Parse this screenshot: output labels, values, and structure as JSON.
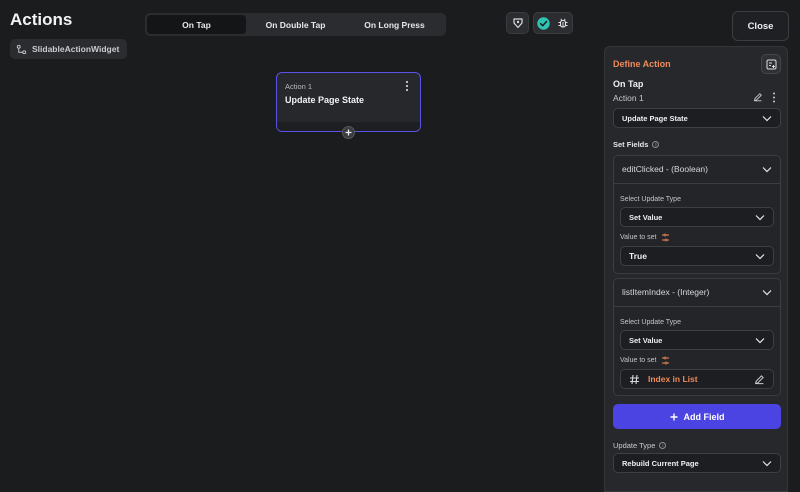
{
  "header": {
    "title": "Actions",
    "widget_chip": "SlidableActionWidget",
    "tabs": [
      {
        "label": "On Tap",
        "active": true
      },
      {
        "label": "On Double Tap",
        "active": false
      },
      {
        "label": "On Long Press",
        "active": false
      }
    ],
    "close_label": "Close"
  },
  "canvas": {
    "node": {
      "label": "Action 1",
      "name": "Update Page State"
    }
  },
  "panel": {
    "title": "Define Action",
    "trigger": "On Tap",
    "action_label": "Action 1",
    "action_type": "Update Page State",
    "set_fields_label": "Set Fields",
    "fields": [
      {
        "name": "editClicked - (Boolean)",
        "update_type_label": "Select Update Type",
        "update_type": "Set Value",
        "value_label": "Value to set",
        "value": "True"
      },
      {
        "name": "listItemIndex - (Integer)",
        "update_type_label": "Select Update Type",
        "update_type": "Set Value",
        "value_label": "Value to set",
        "value": "Index in List"
      }
    ],
    "add_field_label": "Add Field",
    "update_type_label": "Update Type",
    "update_type_value": "Rebuild Current Page"
  },
  "colors": {
    "accent": "#4b44e3",
    "orange": "#ef8a5b",
    "success": "#2fc4b2"
  }
}
